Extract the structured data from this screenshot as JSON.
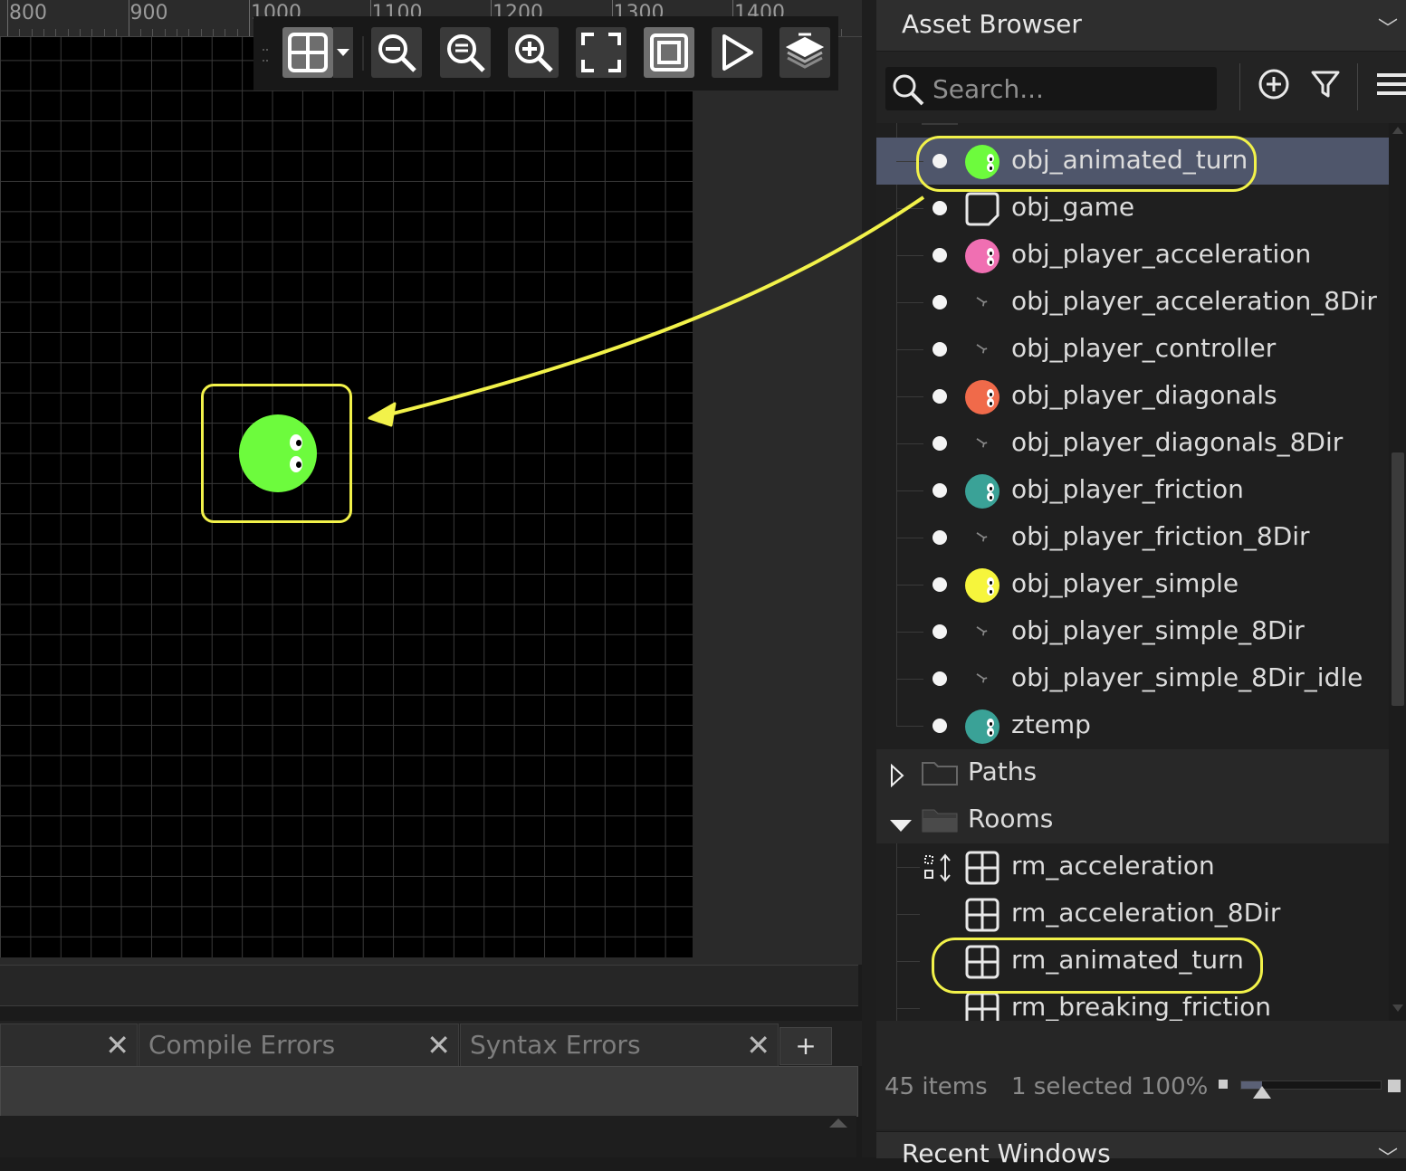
{
  "ruler": {
    "labels": [
      "800",
      "900",
      "1000",
      "1100",
      "1200",
      "1300",
      "1400"
    ]
  },
  "toolbar": {
    "buttons": [
      {
        "name": "grid-toggle",
        "icon": "grid-icon"
      },
      {
        "name": "zoom-out",
        "icon": "zoom-out-icon"
      },
      {
        "name": "zoom-reset",
        "icon": "zoom-reset-icon"
      },
      {
        "name": "zoom-in",
        "icon": "zoom-in-icon"
      },
      {
        "name": "fit-view",
        "icon": "fullscreen-icon"
      },
      {
        "name": "toggle-frame",
        "icon": "frame-icon"
      },
      {
        "name": "run",
        "icon": "play-icon"
      },
      {
        "name": "layers",
        "icon": "layers-icon"
      }
    ]
  },
  "room": {
    "instance_sprite": "green-player-face",
    "instance_color": "#6dfb3d"
  },
  "output": {
    "tabs": [
      {
        "label": "",
        "close": "✕"
      },
      {
        "label": "Compile Errors",
        "close": "✕"
      },
      {
        "label": "Syntax Errors",
        "close": "✕"
      }
    ],
    "add_label": "+"
  },
  "asset_browser": {
    "title": "Asset Browser",
    "collapse_glyph": "﹀",
    "search_placeholder": "Search...",
    "objects": [
      {
        "name": "obj_animated_turn",
        "sprite": "face",
        "color": "#6dfb3d",
        "selected": true
      },
      {
        "name": "obj_game",
        "sprite": "empty",
        "color": "",
        "selected": false
      },
      {
        "name": "obj_player_acceleration",
        "sprite": "face",
        "color": "#f06fb2",
        "selected": false
      },
      {
        "name": "obj_player_acceleration_8Dir",
        "sprite": "8dir",
        "color": "",
        "selected": false
      },
      {
        "name": "obj_player_controller",
        "sprite": "8dir",
        "color": "",
        "selected": false
      },
      {
        "name": "obj_player_diagonals",
        "sprite": "face",
        "color": "#f06a4a",
        "selected": false
      },
      {
        "name": "obj_player_diagonals_8Dir",
        "sprite": "8dir",
        "color": "",
        "selected": false
      },
      {
        "name": "obj_player_friction",
        "sprite": "face",
        "color": "#3aa297",
        "selected": false
      },
      {
        "name": "obj_player_friction_8Dir",
        "sprite": "8dir",
        "color": "",
        "selected": false
      },
      {
        "name": "obj_player_simple",
        "sprite": "face",
        "color": "#f6f53c",
        "selected": false
      },
      {
        "name": "obj_player_simple_8Dir",
        "sprite": "8dir",
        "color": "",
        "selected": false
      },
      {
        "name": "obj_player_simple_8Dir_idle",
        "sprite": "8dir",
        "color": "",
        "selected": false
      },
      {
        "name": "ztemp",
        "sprite": "face",
        "color": "#3aa297",
        "selected": false
      }
    ],
    "folders": [
      {
        "name": "Paths",
        "expanded": false
      },
      {
        "name": "Rooms",
        "expanded": true
      }
    ],
    "rooms": [
      {
        "name": "rm_acceleration",
        "start_room": true
      },
      {
        "name": "rm_acceleration_8Dir",
        "start_room": false
      },
      {
        "name": "rm_animated_turn",
        "start_room": false
      },
      {
        "name": "rm_breaking_friction",
        "start_room": false
      }
    ],
    "status": {
      "items": "45 items",
      "selected": "1 selected",
      "zoom": "100%",
      "zoom_level": 0.15
    }
  },
  "recent_windows": {
    "title": "Recent Windows",
    "collapse_glyph": "﹀"
  },
  "colors": {
    "highlight": "#f2f24a",
    "selection": "#4f566b"
  }
}
